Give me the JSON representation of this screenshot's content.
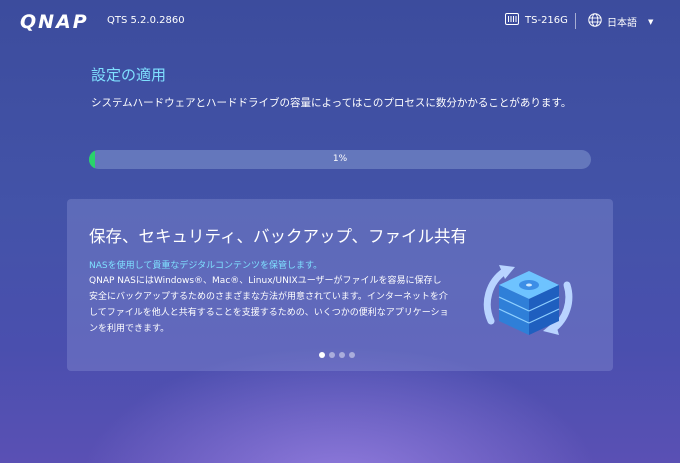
{
  "header": {
    "logo": "QNAP",
    "version": "QTS 5.2.0.2860",
    "device_icon": "nas-device-icon",
    "device_name": "TS-216G",
    "language_icon": "globe-icon",
    "language": "日本語"
  },
  "setup": {
    "title": "設定の適用",
    "description": "システムハードウェアとハードドライブの容量によってはこのプロセスに数分かかることがあります。",
    "progress_label": "1%",
    "progress_fraction": 0.01,
    "progress_color": "#29d36a"
  },
  "card": {
    "title": "保存、セキュリティ、バックアップ、ファイル共有",
    "subtitle": "NASを使用して貴重なデジタルコンテンツを保管します。",
    "body": "QNAP NASにはWindows®、Mac®、Linux/UNIXユーザーがファイルを容易に保存し安全にバックアップするためのさまざまな方法が用意されています。インターネットを介してファイルを他人と共有することを支援するための、いくつかの便利なアプリケーションを利用できます。",
    "illustration": "nas-backup-sync-icon",
    "slides_total": 4,
    "active_slide": 0
  }
}
